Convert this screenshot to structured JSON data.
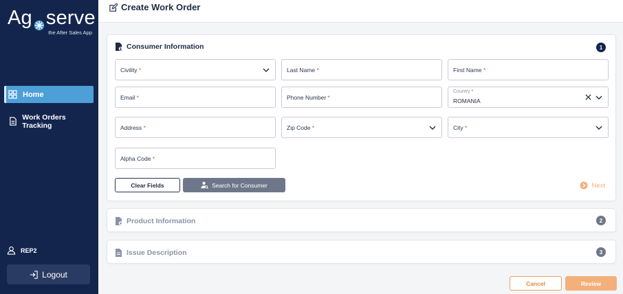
{
  "app": {
    "logo_part1": "Ag",
    "logo_part2": "serve",
    "tagline": "the After Sales App"
  },
  "sidebar": {
    "items": [
      {
        "label": "Home",
        "icon": "grid-icon",
        "active": true
      },
      {
        "label": "Work Orders Tracking",
        "icon": "document-icon",
        "active": false
      }
    ],
    "user": {
      "name": "REP2",
      "icon": "user-icon"
    },
    "logout_label": "Logout"
  },
  "header": {
    "title": "Create Work Order",
    "icon": "edit-icon"
  },
  "sections": [
    {
      "title": "Consumer Information",
      "step": "1",
      "state": "active"
    },
    {
      "title": "Product Information",
      "step": "2",
      "state": "inactive"
    },
    {
      "title": "Issue Description",
      "step": "3",
      "state": "inactive"
    }
  ],
  "form": {
    "civility": {
      "label": "Civility",
      "required_mark": "*"
    },
    "last_name": {
      "label": "Last Name",
      "required_mark": "*"
    },
    "first_name": {
      "label": "First Name",
      "required_mark": "*"
    },
    "email": {
      "label": "Email",
      "required_mark": "*"
    },
    "phone": {
      "label": "Phone Number",
      "required_mark": "*"
    },
    "country": {
      "label": "Country",
      "required_mark": "*",
      "value": "ROMANIA"
    },
    "address": {
      "label": "Address",
      "required_mark": "*"
    },
    "zip": {
      "label": "Zip Code",
      "required_mark": "*"
    },
    "city": {
      "label": "City",
      "required_mark": "*"
    },
    "alpha_code": {
      "label": "Alpha Code",
      "required_mark": "*"
    }
  },
  "actions": {
    "clear_fields": "Clear Fields",
    "search_consumer": "Search for Consumer",
    "next": "Next",
    "cancel": "Cancel",
    "review": "Review"
  },
  "colors": {
    "sidebar_bg": "#14254d",
    "active_nav": "#4d9fd8",
    "accent_orange": "#e8863a",
    "required": "#e0523a"
  }
}
